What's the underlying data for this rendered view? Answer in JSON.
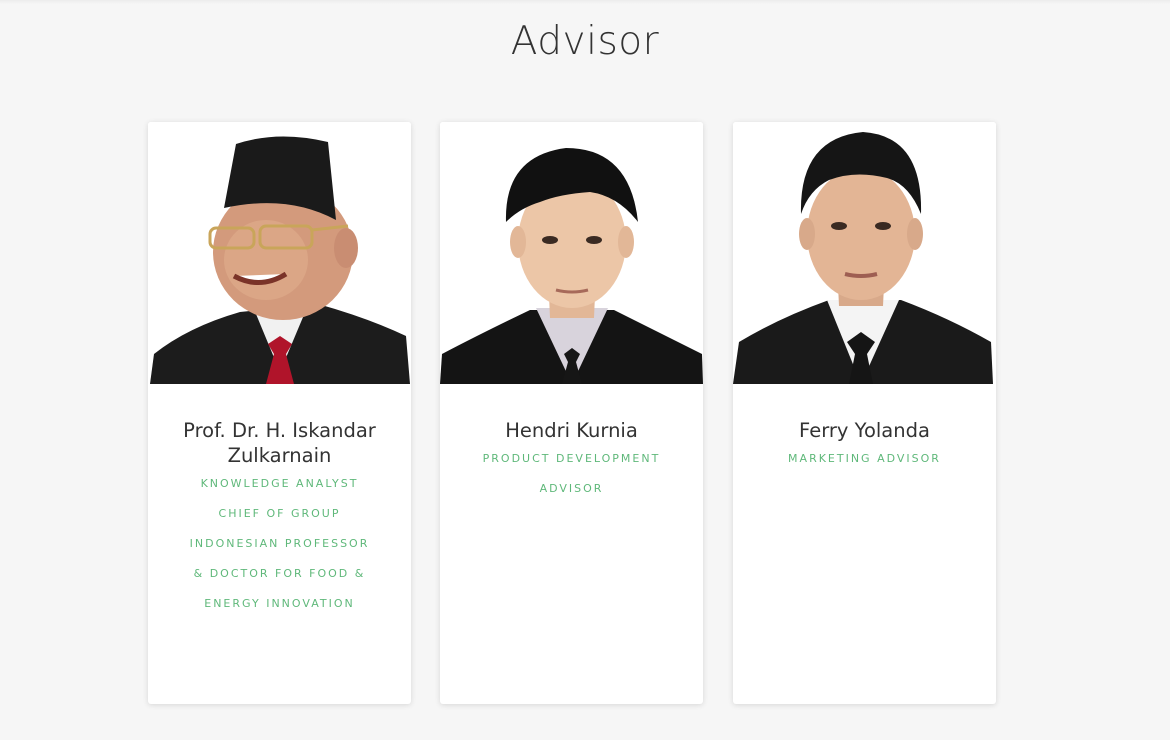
{
  "section": {
    "title": "Advisor"
  },
  "colors": {
    "background": "#f6f6f6",
    "card": "#ffffff",
    "title_text": "#333333",
    "role_accent": "#5fb87a"
  },
  "advisors": [
    {
      "name": "Prof. Dr. H. Iskandar Zulkarnain",
      "roles": [
        "Knowledge Analyst",
        "Chief of Group",
        "Indonesian Professor",
        "& Doctor for Food &",
        "Energy Innovation"
      ],
      "photo": "portrait-man-black-peci-glasses-suit"
    },
    {
      "name": "Hendri Kurnia",
      "roles": [
        "Product Development",
        "Advisor"
      ],
      "photo": "portrait-young-man-suit"
    },
    {
      "name": "Ferry Yolanda",
      "roles": [
        "Marketing Advisor"
      ],
      "photo": "portrait-young-man-suit"
    }
  ]
}
